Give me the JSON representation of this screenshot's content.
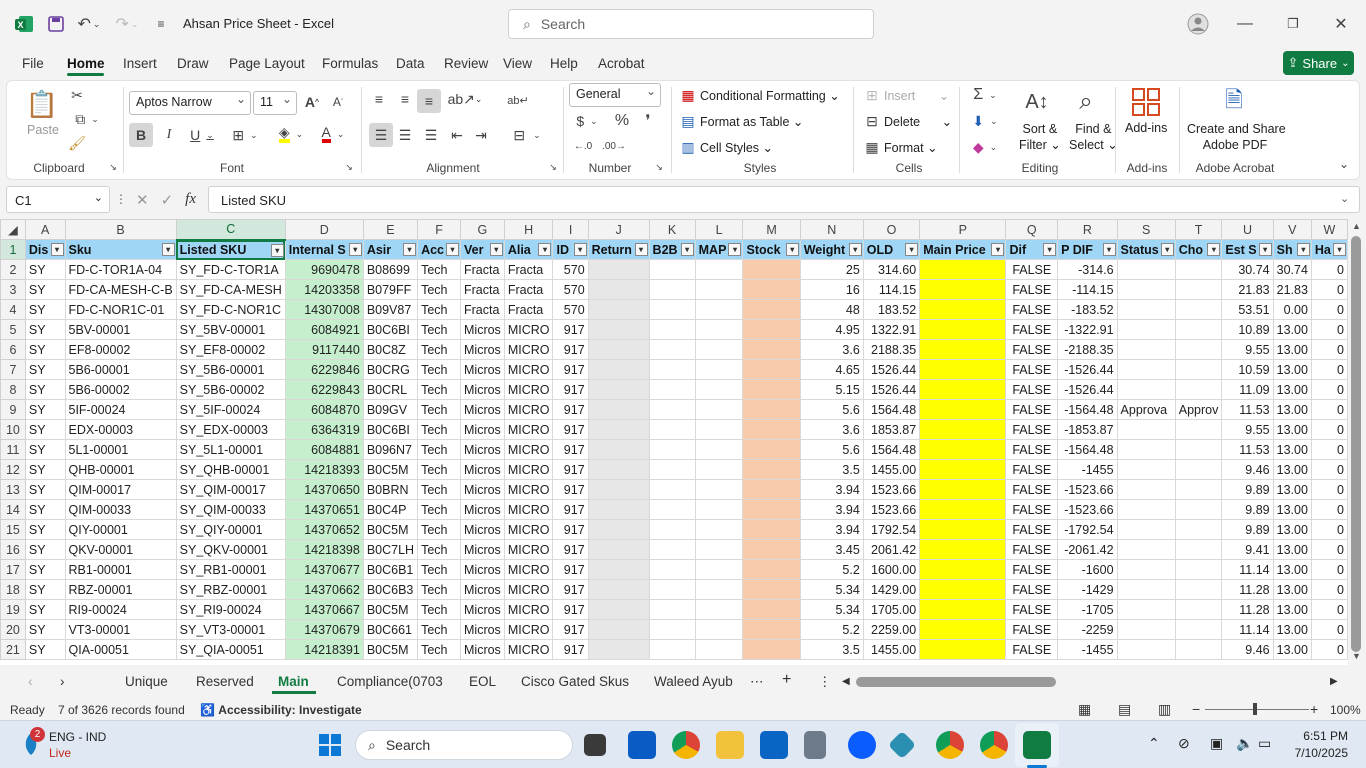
{
  "window": {
    "title": "Ahsan Price Sheet  -  Excel",
    "search_placeholder": "Search"
  },
  "menu": [
    "File",
    "Home",
    "Insert",
    "Draw",
    "Page Layout",
    "Formulas",
    "Data",
    "Review",
    "View",
    "Help",
    "Acrobat"
  ],
  "share_label": "Share",
  "ribbon": {
    "clipboard": {
      "paste": "Paste",
      "label": "Clipboard"
    },
    "font": {
      "name": "Aptos Narrow",
      "size": "11",
      "label": "Font"
    },
    "alignment": {
      "label": "Alignment"
    },
    "number": {
      "format": "General",
      "label": "Number"
    },
    "styles": {
      "conditional": "Conditional Formatting",
      "table": "Format as Table",
      "cell": "Cell Styles",
      "label": "Styles"
    },
    "cells": {
      "insert": "Insert",
      "delete": "Delete",
      "format": "Format",
      "label": "Cells"
    },
    "editing": {
      "sort1": "Sort &",
      "sort2": "Filter",
      "find1": "Find &",
      "find2": "Select",
      "label": "Editing"
    },
    "addins": {
      "btn": "Add-ins",
      "label": "Add-ins"
    },
    "acrobat": {
      "btn1": "Create and Share",
      "btn2": "Adobe PDF",
      "label": "Adobe Acrobat"
    }
  },
  "formula_bar": {
    "name_box": "C1",
    "fx": "fx",
    "content": "Listed SKU"
  },
  "columns": [
    "A",
    "B",
    "C",
    "D",
    "E",
    "F",
    "G",
    "H",
    "I",
    "J",
    "K",
    "L",
    "M",
    "N",
    "O",
    "P",
    "Q",
    "R",
    "S",
    "T",
    "U",
    "V",
    "W"
  ],
  "headers": [
    "Dis",
    "Sku",
    "Listed SKU",
    "Internal S",
    "Asir",
    "Acc",
    "Ver",
    "Alia",
    "ID",
    "Return",
    "B2B",
    "MAP",
    "Stock",
    "Weight",
    "OLD",
    "Main Price",
    "Dif",
    "P DIF",
    "Status",
    "Cho",
    "Est S",
    "Sh",
    "Ha"
  ],
  "rows": [
    {
      "n": "2",
      "a": "SY",
      "sku": "FD-C-TOR1A-04",
      "listed": "SY_FD-C-TOR1A",
      "internal": "9690478",
      "asin": "B08699",
      "acc": "Tech",
      "ver": "Fracta",
      "alia": "Fracta",
      "id": "570",
      "weight": "25",
      "old": "314.60",
      "dif": "FALSE",
      "pdif": "-314.6",
      "status": "",
      "cho": "",
      "est": "30.74",
      "sh": "30.74",
      "ha": "0"
    },
    {
      "n": "3",
      "a": "SY",
      "sku": "FD-CA-MESH-C-B",
      "listed": "SY_FD-CA-MESH",
      "internal": "14203358",
      "asin": "B079FF",
      "acc": "Tech",
      "ver": "Fracta",
      "alia": "Fracta",
      "id": "570",
      "weight": "16",
      "old": "114.15",
      "dif": "FALSE",
      "pdif": "-114.15",
      "status": "",
      "cho": "",
      "est": "21.83",
      "sh": "21.83",
      "ha": "0"
    },
    {
      "n": "4",
      "a": "SY",
      "sku": "FD-C-NOR1C-01",
      "listed": "SY_FD-C-NOR1C",
      "internal": "14307008",
      "asin": "B09V87",
      "acc": "Tech",
      "ver": "Fracta",
      "alia": "Fracta",
      "id": "570",
      "weight": "48",
      "old": "183.52",
      "dif": "FALSE",
      "pdif": "-183.52",
      "status": "",
      "cho": "",
      "est": "53.51",
      "sh": "0.00",
      "ha": "0"
    },
    {
      "n": "5",
      "a": "SY",
      "sku": "5BV-00001",
      "listed": "SY_5BV-00001",
      "internal": "6084921",
      "asin": "B0C6BI",
      "acc": "Tech",
      "ver": "Micros",
      "alia": "MICRO",
      "id": "917",
      "weight": "4.95",
      "old": "1322.91",
      "dif": "FALSE",
      "pdif": "-1322.91",
      "status": "",
      "cho": "",
      "est": "10.89",
      "sh": "13.00",
      "ha": "0"
    },
    {
      "n": "6",
      "a": "SY",
      "sku": "EF8-00002",
      "listed": "SY_EF8-00002",
      "internal": "9117440",
      "asin": "B0C8Z",
      "acc": "Tech",
      "ver": "Micros",
      "alia": "MICRO",
      "id": "917",
      "weight": "3.6",
      "old": "2188.35",
      "dif": "FALSE",
      "pdif": "-2188.35",
      "status": "",
      "cho": "",
      "est": "9.55",
      "sh": "13.00",
      "ha": "0"
    },
    {
      "n": "7",
      "a": "SY",
      "sku": "5B6-00001",
      "listed": "SY_5B6-00001",
      "internal": "6229846",
      "asin": "B0CRG",
      "acc": "Tech",
      "ver": "Micros",
      "alia": "MICRO",
      "id": "917",
      "weight": "4.65",
      "old": "1526.44",
      "dif": "FALSE",
      "pdif": "-1526.44",
      "status": "",
      "cho": "",
      "est": "10.59",
      "sh": "13.00",
      "ha": "0"
    },
    {
      "n": "8",
      "a": "SY",
      "sku": "5B6-00002",
      "listed": "SY_5B6-00002",
      "internal": "6229843",
      "asin": "B0CRL",
      "acc": "Tech",
      "ver": "Micros",
      "alia": "MICRO",
      "id": "917",
      "weight": "5.15",
      "old": "1526.44",
      "dif": "FALSE",
      "pdif": "-1526.44",
      "status": "",
      "cho": "",
      "est": "11.09",
      "sh": "13.00",
      "ha": "0"
    },
    {
      "n": "9",
      "a": "SY",
      "sku": "5IF-00024",
      "listed": "SY_5IF-00024",
      "internal": "6084870",
      "asin": "B09GV",
      "acc": "Tech",
      "ver": "Micros",
      "alia": "MICRO",
      "id": "917",
      "weight": "5.6",
      "old": "1564.48",
      "dif": "FALSE",
      "pdif": "-1564.48",
      "status": "Approva",
      "cho": "Approv",
      "est": "11.53",
      "sh": "13.00",
      "ha": "0"
    },
    {
      "n": "10",
      "a": "SY",
      "sku": "EDX-00003",
      "listed": "SY_EDX-00003",
      "internal": "6364319",
      "asin": "B0C6BI",
      "acc": "Tech",
      "ver": "Micros",
      "alia": "MICRO",
      "id": "917",
      "weight": "3.6",
      "old": "1853.87",
      "dif": "FALSE",
      "pdif": "-1853.87",
      "status": "",
      "cho": "",
      "est": "9.55",
      "sh": "13.00",
      "ha": "0"
    },
    {
      "n": "11",
      "a": "SY",
      "sku": "5L1-00001",
      "listed": "SY_5L1-00001",
      "internal": "6084881",
      "asin": "B096N7",
      "acc": "Tech",
      "ver": "Micros",
      "alia": "MICRO",
      "id": "917",
      "weight": "5.6",
      "old": "1564.48",
      "dif": "FALSE",
      "pdif": "-1564.48",
      "status": "",
      "cho": "",
      "est": "11.53",
      "sh": "13.00",
      "ha": "0"
    },
    {
      "n": "12",
      "a": "SY",
      "sku": "QHB-00001",
      "listed": "SY_QHB-00001",
      "internal": "14218393",
      "asin": "B0C5M",
      "acc": "Tech",
      "ver": "Micros",
      "alia": "MICRO",
      "id": "917",
      "weight": "3.5",
      "old": "1455.00",
      "dif": "FALSE",
      "pdif": "-1455",
      "status": "",
      "cho": "",
      "est": "9.46",
      "sh": "13.00",
      "ha": "0"
    },
    {
      "n": "13",
      "a": "SY",
      "sku": "QIM-00017",
      "listed": "SY_QIM-00017",
      "internal": "14370650",
      "asin": "B0BRN",
      "acc": "Tech",
      "ver": "Micros",
      "alia": "MICRO",
      "id": "917",
      "weight": "3.94",
      "old": "1523.66",
      "dif": "FALSE",
      "pdif": "-1523.66",
      "status": "",
      "cho": "",
      "est": "9.89",
      "sh": "13.00",
      "ha": "0"
    },
    {
      "n": "14",
      "a": "SY",
      "sku": "QIM-00033",
      "listed": "SY_QIM-00033",
      "internal": "14370651",
      "asin": "B0C4P",
      "acc": "Tech",
      "ver": "Micros",
      "alia": "MICRO",
      "id": "917",
      "weight": "3.94",
      "old": "1523.66",
      "dif": "FALSE",
      "pdif": "-1523.66",
      "status": "",
      "cho": "",
      "est": "9.89",
      "sh": "13.00",
      "ha": "0"
    },
    {
      "n": "15",
      "a": "SY",
      "sku": "QIY-00001",
      "listed": "SY_QIY-00001",
      "internal": "14370652",
      "asin": "B0C5M",
      "acc": "Tech",
      "ver": "Micros",
      "alia": "MICRO",
      "id": "917",
      "weight": "3.94",
      "old": "1792.54",
      "dif": "FALSE",
      "pdif": "-1792.54",
      "status": "",
      "cho": "",
      "est": "9.89",
      "sh": "13.00",
      "ha": "0"
    },
    {
      "n": "16",
      "a": "SY",
      "sku": "QKV-00001",
      "listed": "SY_QKV-00001",
      "internal": "14218398",
      "asin": "B0C7LH",
      "acc": "Tech",
      "ver": "Micros",
      "alia": "MICRO",
      "id": "917",
      "weight": "3.45",
      "old": "2061.42",
      "dif": "FALSE",
      "pdif": "-2061.42",
      "status": "",
      "cho": "",
      "est": "9.41",
      "sh": "13.00",
      "ha": "0"
    },
    {
      "n": "17",
      "a": "SY",
      "sku": "RB1-00001",
      "listed": "SY_RB1-00001",
      "internal": "14370677",
      "asin": "B0C6B1",
      "acc": "Tech",
      "ver": "Micros",
      "alia": "MICRO",
      "id": "917",
      "weight": "5.2",
      "old": "1600.00",
      "dif": "FALSE",
      "pdif": "-1600",
      "status": "",
      "cho": "",
      "est": "11.14",
      "sh": "13.00",
      "ha": "0"
    },
    {
      "n": "18",
      "a": "SY",
      "sku": "RBZ-00001",
      "listed": "SY_RBZ-00001",
      "internal": "14370662",
      "asin": "B0C6B3",
      "acc": "Tech",
      "ver": "Micros",
      "alia": "MICRO",
      "id": "917",
      "weight": "5.34",
      "old": "1429.00",
      "dif": "FALSE",
      "pdif": "-1429",
      "status": "",
      "cho": "",
      "est": "11.28",
      "sh": "13.00",
      "ha": "0"
    },
    {
      "n": "19",
      "a": "SY",
      "sku": "RI9-00024",
      "listed": "SY_RI9-00024",
      "internal": "14370667",
      "asin": "B0C5M",
      "acc": "Tech",
      "ver": "Micros",
      "alia": "MICRO",
      "id": "917",
      "weight": "5.34",
      "old": "1705.00",
      "dif": "FALSE",
      "pdif": "-1705",
      "status": "",
      "cho": "",
      "est": "11.28",
      "sh": "13.00",
      "ha": "0"
    },
    {
      "n": "20",
      "a": "SY",
      "sku": "VT3-00001",
      "listed": "SY_VT3-00001",
      "internal": "14370679",
      "asin": "B0C661",
      "acc": "Tech",
      "ver": "Micros",
      "alia": "MICRO",
      "id": "917",
      "weight": "5.2",
      "old": "2259.00",
      "dif": "FALSE",
      "pdif": "-2259",
      "status": "",
      "cho": "",
      "est": "11.14",
      "sh": "13.00",
      "ha": "0"
    },
    {
      "n": "21",
      "a": "SY",
      "sku": "QIA-00051",
      "listed": "SY_QIA-00051",
      "internal": "14218391",
      "asin": "B0C5M",
      "acc": "Tech",
      "ver": "Micros",
      "alia": "MICRO",
      "id": "917",
      "weight": "3.5",
      "old": "1455.00",
      "dif": "FALSE",
      "pdif": "-1455",
      "status": "",
      "cho": "",
      "est": "9.46",
      "sh": "13.00",
      "ha": "0"
    }
  ],
  "sheets": [
    "Unique",
    "Reserved",
    "Main",
    "Compliance(0703",
    "EOL",
    "Cisco Gated Skus",
    "Waleed Ayub"
  ],
  "active_sheet": "Main",
  "status": {
    "ready": "Ready",
    "records": "7 of 3626 records found",
    "accessibility": "Accessibility: Investigate",
    "zoom": "100%"
  },
  "taskbar": {
    "weather_lang": "ENG - IND",
    "live": "Live",
    "badge": "2",
    "search": "Search",
    "time": "6:51 PM",
    "date": "7/10/2025"
  },
  "colors": {
    "excel_green": "#107c41",
    "header_blue": "#9fd6f5",
    "green_fill": "#c6efce",
    "orange_fill": "#f8cbad",
    "yellow_fill": "#ffff00"
  }
}
